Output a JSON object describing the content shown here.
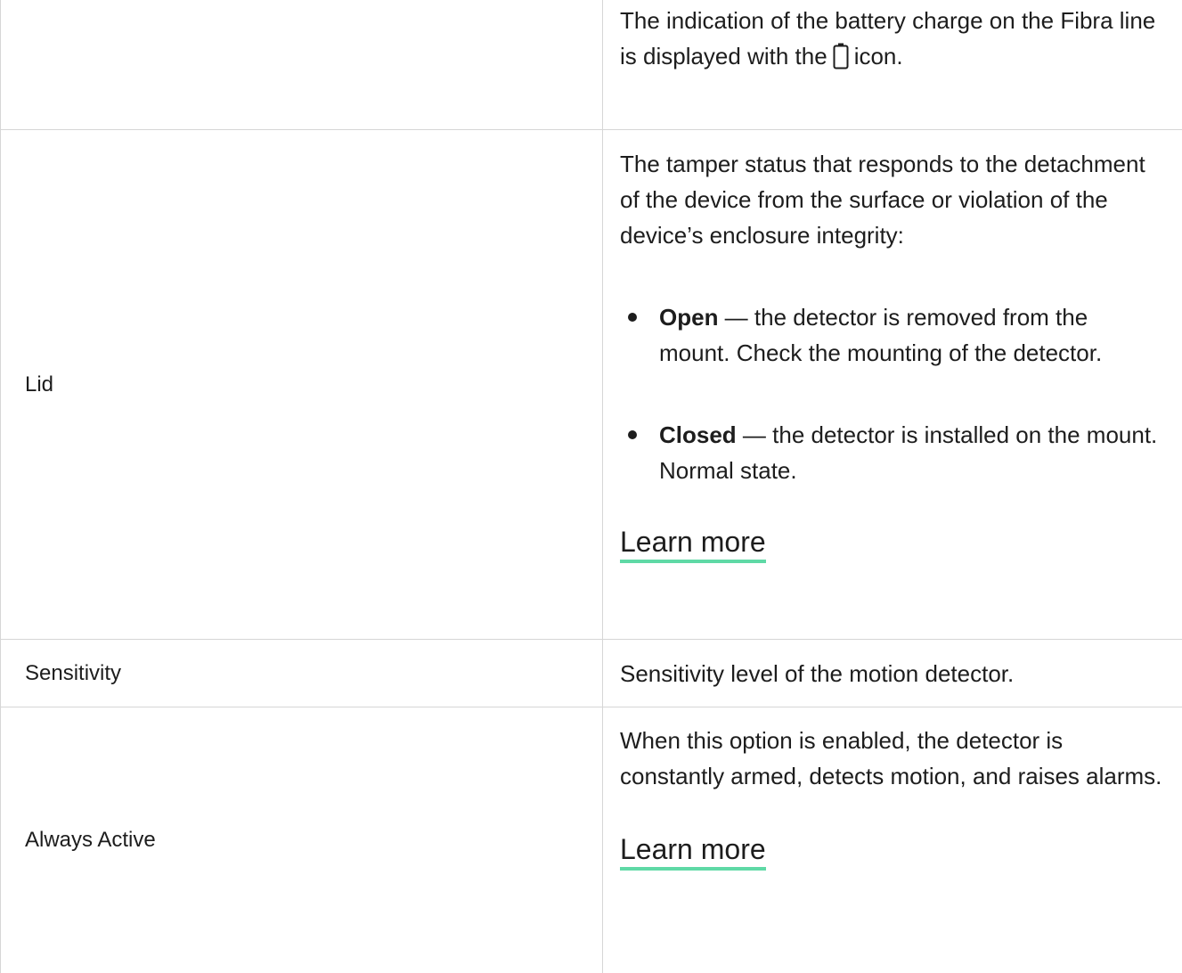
{
  "rows": [
    {
      "label": "",
      "text_before_icon": "The indication of the battery charge on the Fibra line is displayed with the",
      "icon": "battery-icon",
      "text_after_icon": "icon."
    },
    {
      "label": "Lid",
      "intro": "The tamper status that responds to the detachment of the device from the surface or violation of the device’s enclosure integrity:",
      "bullets": [
        {
          "term": "Open",
          "desc": " — the detector is removed from the mount. Check the mounting of the detector."
        },
        {
          "term": "Closed",
          "desc": " — the detector is installed on the mount. Normal state."
        }
      ],
      "link": "Learn more"
    },
    {
      "label": "Sensitivity",
      "text": "Sensitivity level of the motion detector."
    },
    {
      "label": "Always Active",
      "text": "When this option is enabled, the detector is constantly armed, detects motion, and raises alarms.",
      "link": "Learn more"
    }
  ],
  "colors": {
    "border": "#d6d6d6",
    "link_underline": "#5fd9a6",
    "text": "#1d1d1d"
  }
}
